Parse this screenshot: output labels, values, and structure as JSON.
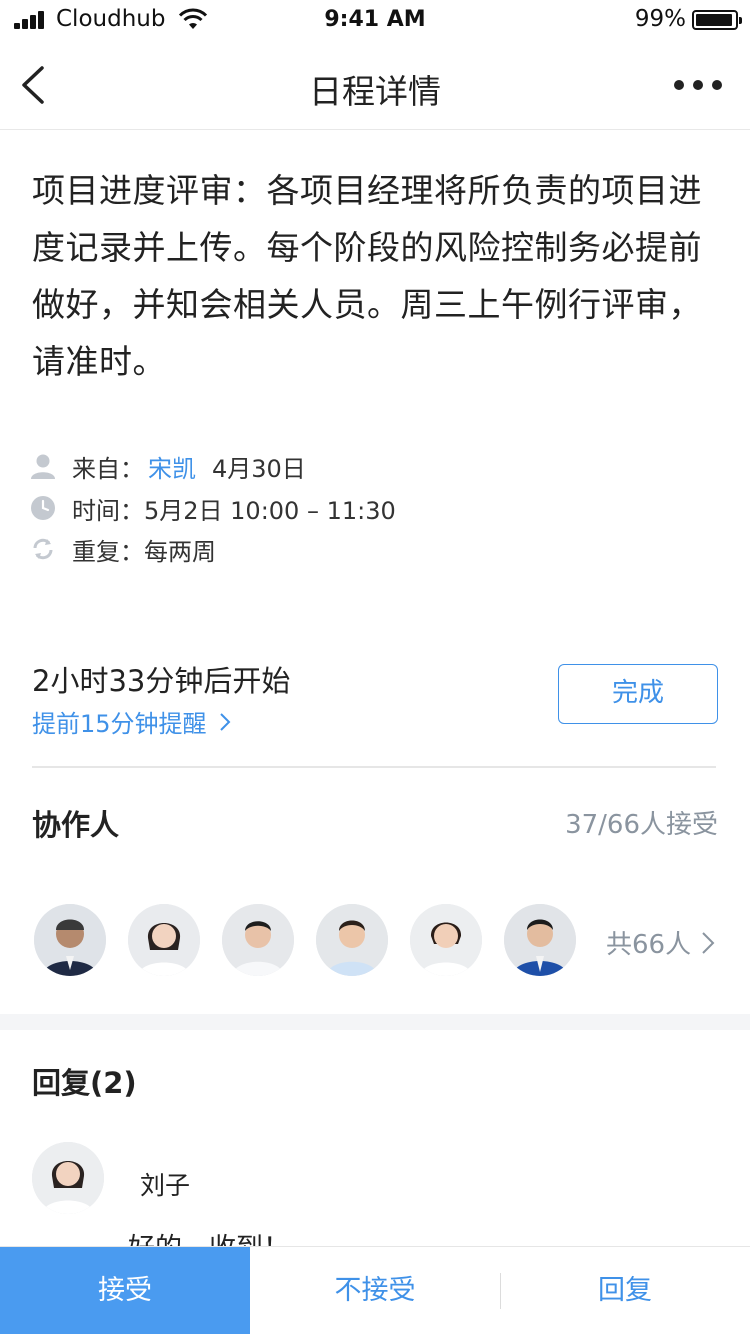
{
  "status_bar": {
    "carrier": "Cloudhub",
    "time": "9:41 AM",
    "battery": "99%"
  },
  "nav": {
    "title": "日程详情"
  },
  "event": {
    "description": "项目进度评审：各项目经理将所负责的项目进度记录并上传。每个阶段的风险控制务必提前做好，并知会相关人员。周三上午例行评审，请准时。",
    "from_label": "来自：",
    "from_name": "宋凯",
    "from_date": "4月30日",
    "time_label": "时间：",
    "time_value": "5月2日 10:00 – 11:30",
    "repeat_label": "重复：",
    "repeat_value": "每两周"
  },
  "schedule": {
    "starts_in": "2小时33分钟后开始",
    "reminder": "提前15分钟提醒",
    "done_label": "完成"
  },
  "collaborators": {
    "title": "协作人",
    "accepted": "37/66人接受",
    "total": "共66人"
  },
  "replies": {
    "title": "回复(2)",
    "items": [
      {
        "name": "刘子",
        "text": "好的，收到！"
      }
    ]
  },
  "actions": {
    "accept": "接受",
    "decline": "不接受",
    "reply": "回复"
  },
  "colors": {
    "accent": "#3f91e8",
    "accept_bg": "#4a9bf0",
    "muted": "#8a949f"
  }
}
